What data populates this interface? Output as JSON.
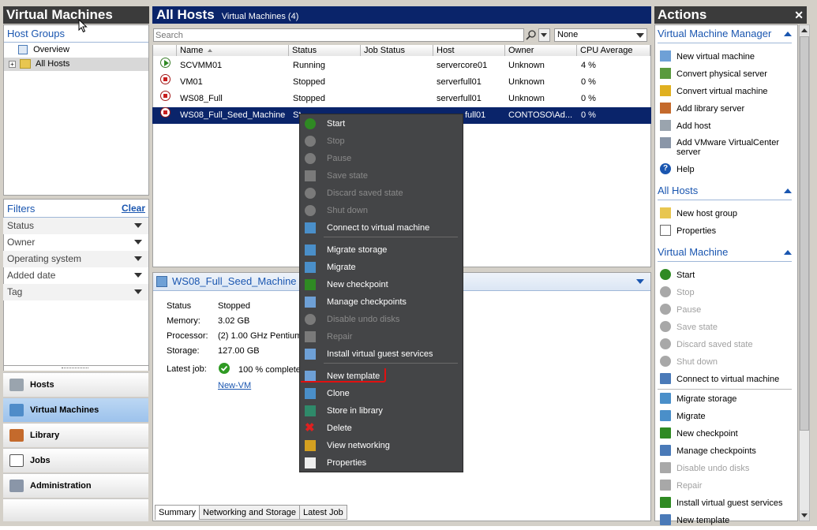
{
  "left_panel": {
    "title": "Virtual Machines",
    "host_groups_label": "Host Groups",
    "tree": [
      {
        "label": "Overview"
      },
      {
        "label": "All Hosts"
      }
    ],
    "filters_label": "Filters",
    "clear_label": "Clear",
    "filters": [
      "Status",
      "Owner",
      "Operating system",
      "Added date",
      "Tag"
    ],
    "nav": [
      "Hosts",
      "Virtual Machines",
      "Library",
      "Jobs",
      "Administration"
    ]
  },
  "main": {
    "title": "All Hosts",
    "subtitle": "Virtual Machines (4)",
    "search_placeholder": "Search",
    "filter_value": "None",
    "columns": [
      "Name",
      "Status",
      "Job Status",
      "Host",
      "Owner",
      "CPU Average"
    ],
    "rows": [
      {
        "name": "SCVMM01",
        "status": "Running",
        "job_status": "",
        "host": "servercore01",
        "owner": "Unknown",
        "cpu": "4 %",
        "state": "running"
      },
      {
        "name": "VM01",
        "status": "Stopped",
        "job_status": "",
        "host": "serverfull01",
        "owner": "Unknown",
        "cpu": "0 %",
        "state": "stopped"
      },
      {
        "name": "WS08_Full",
        "status": "Stopped",
        "job_status": "",
        "host": "serverfull01",
        "owner": "Unknown",
        "cpu": "0 %",
        "state": "stopped"
      },
      {
        "name": "WS08_Full_Seed_Machine",
        "status": "St",
        "job_status": "",
        "host": "full01",
        "owner": "CONTOSO\\Ad...",
        "cpu": "0 %",
        "state": "stopped"
      }
    ]
  },
  "details": {
    "title": "WS08_Full_Seed_Machine",
    "fields": [
      {
        "label": "Status",
        "value": "Stopped"
      },
      {
        "label": "Memory:",
        "value": "3.02 GB"
      },
      {
        "label": "Processor:",
        "value": "(2) 1.00 GHz Pentium"
      },
      {
        "label": "Storage:",
        "value": "127.00 GB"
      }
    ],
    "latest_job_label": "Latest job:",
    "latest_job_value": "100 % complete",
    "latest_job_link": "New-VM",
    "tabs": [
      "Summary",
      "Networking and Storage",
      "Latest Job"
    ]
  },
  "context_menu": {
    "items": [
      {
        "label": "Start",
        "enabled": true,
        "icon": "start-icon"
      },
      {
        "label": "Stop",
        "enabled": false,
        "icon": "stop-icon"
      },
      {
        "label": "Pause",
        "enabled": false,
        "icon": "pause-icon"
      },
      {
        "label": "Save state",
        "enabled": false,
        "icon": "save-state-icon"
      },
      {
        "label": "Discard saved state",
        "enabled": false,
        "icon": "discard-icon"
      },
      {
        "label": "Shut down",
        "enabled": false,
        "icon": "shutdown-icon"
      },
      {
        "label": "Connect to virtual machine",
        "enabled": true,
        "icon": "connect-icon"
      },
      {
        "label": "Migrate storage",
        "enabled": true,
        "icon": "migrate-storage-icon"
      },
      {
        "label": "Migrate",
        "enabled": true,
        "icon": "migrate-icon"
      },
      {
        "label": "New checkpoint",
        "enabled": true,
        "icon": "checkpoint-icon"
      },
      {
        "label": "Manage checkpoints",
        "enabled": true,
        "icon": "manage-checkpoints-icon"
      },
      {
        "label": "Disable undo disks",
        "enabled": false,
        "icon": "undo-disks-icon"
      },
      {
        "label": "Repair",
        "enabled": false,
        "icon": "repair-icon"
      },
      {
        "label": "Install virtual guest services",
        "enabled": true,
        "icon": "guest-services-icon"
      },
      {
        "label": "New template",
        "enabled": true,
        "icon": "new-template-icon"
      },
      {
        "label": "Clone",
        "enabled": true,
        "icon": "clone-icon"
      },
      {
        "label": "Store in library",
        "enabled": true,
        "icon": "store-library-icon"
      },
      {
        "label": "Delete",
        "enabled": true,
        "icon": "delete-icon"
      },
      {
        "label": "View networking",
        "enabled": true,
        "icon": "networking-icon"
      },
      {
        "label": "Properties",
        "enabled": true,
        "icon": "properties-icon"
      }
    ],
    "highlight_color": "#e01010"
  },
  "actions": {
    "title": "Actions",
    "sections": [
      {
        "title": "Virtual Machine Manager",
        "items": [
          {
            "label": "New virtual machine",
            "enabled": true
          },
          {
            "label": "Convert physical server",
            "enabled": true
          },
          {
            "label": "Convert virtual machine",
            "enabled": true
          },
          {
            "label": "Add library server",
            "enabled": true
          },
          {
            "label": "Add host",
            "enabled": true
          },
          {
            "label": "Add VMware VirtualCenter server",
            "enabled": true
          },
          {
            "label": "Help",
            "enabled": true
          }
        ]
      },
      {
        "title": "All Hosts",
        "items": [
          {
            "label": "New host group",
            "enabled": true
          },
          {
            "label": "Properties",
            "enabled": true
          }
        ]
      },
      {
        "title": "Virtual Machine",
        "items": [
          {
            "label": "Start",
            "enabled": true
          },
          {
            "label": "Stop",
            "enabled": false
          },
          {
            "label": "Pause",
            "enabled": false
          },
          {
            "label": "Save state",
            "enabled": false
          },
          {
            "label": "Discard saved state",
            "enabled": false
          },
          {
            "label": "Shut down",
            "enabled": false
          },
          {
            "label": "Connect to virtual machine",
            "enabled": true
          },
          {
            "label": "Migrate storage",
            "enabled": true
          },
          {
            "label": "Migrate",
            "enabled": true
          },
          {
            "label": "New checkpoint",
            "enabled": true
          },
          {
            "label": "Manage checkpoints",
            "enabled": true
          },
          {
            "label": "Disable undo disks",
            "enabled": false
          },
          {
            "label": "Repair",
            "enabled": false
          },
          {
            "label": "Install virtual guest services",
            "enabled": true
          },
          {
            "label": "New template",
            "enabled": true
          }
        ]
      }
    ]
  },
  "colors": {
    "title_dark": "#3b3b3b",
    "title_blue": "#0a246a",
    "accent": "#1a56b0",
    "menu_bg": "#444547"
  }
}
